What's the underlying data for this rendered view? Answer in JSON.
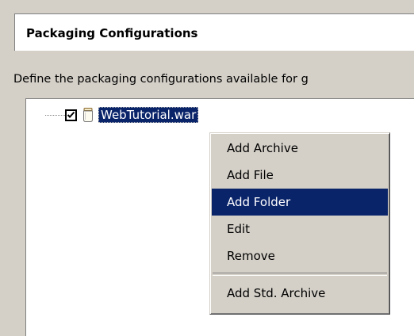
{
  "header": {
    "title": "Packaging Configurations"
  },
  "description": "Define the packaging configurations available for g",
  "tree": {
    "items": [
      {
        "label": "WebTutorial.war",
        "checked": true,
        "selected": true,
        "icon": "jar-icon"
      }
    ]
  },
  "context_menu": {
    "items": [
      {
        "label": "Add Archive"
      },
      {
        "label": "Add File"
      },
      {
        "label": "Add Folder",
        "highlighted": true
      },
      {
        "label": "Edit"
      },
      {
        "label": "Remove"
      },
      {
        "label": "Add Std. Archive"
      }
    ]
  },
  "colors": {
    "background": "#d4d0c8",
    "selection": "#0a246a",
    "panel": "#ffffff"
  }
}
